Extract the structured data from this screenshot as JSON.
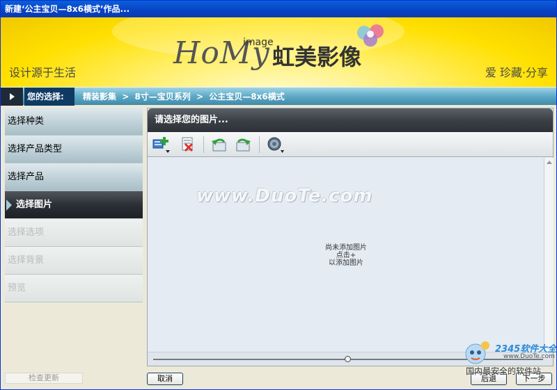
{
  "window": {
    "title": "新建‘公主宝贝—8x6横式’作品..."
  },
  "banner": {
    "slogan_left": "设计源于生活",
    "logo_text": "HoMy",
    "logo_superscript": "image",
    "logo_chinese": "虹美影像",
    "slogan_right": "爱  珍藏·分享"
  },
  "breadcrumb": {
    "label": "您的选择:",
    "items": [
      "精装影集",
      ">",
      "8寸—宝贝系列",
      ">",
      "公主宝贝—8x6横式"
    ]
  },
  "sidebar": {
    "items": [
      {
        "label": "选择种类",
        "state": "done"
      },
      {
        "label": "选择产品类型",
        "state": "done"
      },
      {
        "label": "选择产品",
        "state": "done"
      },
      {
        "label": "选择图片",
        "state": "active"
      },
      {
        "label": "选择选项",
        "state": "pending"
      },
      {
        "label": "选择背景",
        "state": "pending"
      },
      {
        "label": "预览",
        "state": "pending"
      }
    ],
    "check_update_label": "检查更新"
  },
  "panel": {
    "header": "请选择您的图片...",
    "toolbar": {
      "icons": [
        "add-image-icon",
        "remove-image-icon",
        "rotate-left-icon",
        "rotate-right-icon",
        "settings-icon"
      ]
    },
    "watermark": "www.DuoTe.com",
    "empty_message": [
      "尚未添加图片",
      "点击+",
      "以添加图片"
    ],
    "zoom_level": 0.5
  },
  "buttons": {
    "cancel": "取消",
    "back": "后退",
    "next": "下一步"
  },
  "corner_logo": {
    "brand": "2345软件大全",
    "url": "www.DuoTe.com",
    "tagline": "国内最安全的软件站"
  },
  "colors": {
    "title_bar": "#0842c4",
    "banner_yellow": "#ffe000",
    "breadcrumb_teal": "#5ea9c6",
    "active_step": "#2c3036"
  }
}
